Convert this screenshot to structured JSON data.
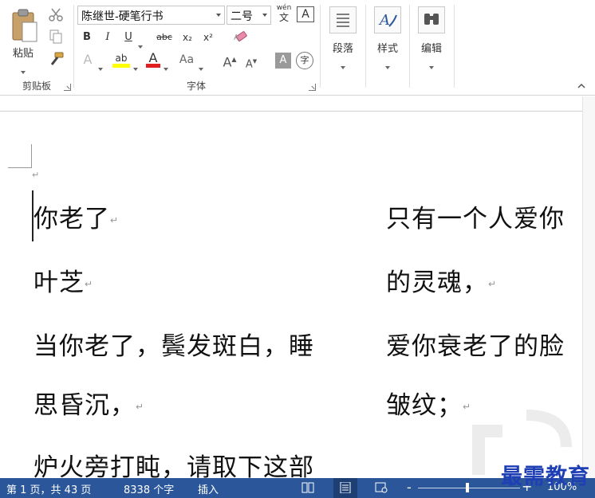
{
  "ribbon": {
    "clipboard": {
      "paste_label": "粘贴",
      "group_label": "剪贴板"
    },
    "font": {
      "font_name": "陈继世-硬笔行书",
      "font_size": "二号",
      "bold": "B",
      "italic": "I",
      "underline": "U",
      "strikethrough": "abc",
      "subscript": "x₂",
      "superscript": "x²",
      "phonetic_top": "wén",
      "phonetic_bottom": "文",
      "char_border": "A",
      "text_effects": "A",
      "highlight": "ab",
      "font_color": "A",
      "change_case": "Aa",
      "grow_font": "A",
      "shrink_font": "A",
      "char_shading": "A",
      "enclose_char": "字",
      "group_label": "字体"
    },
    "paragraph": {
      "label": "段落"
    },
    "styles": {
      "label": "样式"
    },
    "editing": {
      "label": "编辑"
    }
  },
  "document": {
    "left_column": [
      {
        "text": "你老了",
        "mark": "↵"
      },
      {
        "text": "叶芝",
        "mark": "↵"
      },
      {
        "text": "当你老了，鬓发斑白，睡",
        "mark": ""
      },
      {
        "text": "思昏沉，",
        "mark": "↵"
      },
      {
        "text": "炉火旁打盹，请取下这部",
        "mark": ""
      }
    ],
    "right_column": [
      {
        "text": "只有一个人爱你",
        "mark": ""
      },
      {
        "text": "的灵魂，",
        "mark": "↵"
      },
      {
        "text": "爱你衰老了的脸",
        "mark": ""
      },
      {
        "text": "皱纹；",
        "mark": "↵"
      }
    ],
    "top_mark": "↵"
  },
  "status": {
    "page_info": "第 1 页，共 43 页",
    "word_count": "8338 个字",
    "insert_mode": "插入",
    "zoom_minus": "-",
    "zoom_plus": "+",
    "zoom_level": "100%"
  },
  "watermark": "最需教育",
  "colors": {
    "status_bar": "#2b579a",
    "highlight": "#ffff00",
    "font_color": "#e02020",
    "watermark": "#1f3fb5"
  }
}
